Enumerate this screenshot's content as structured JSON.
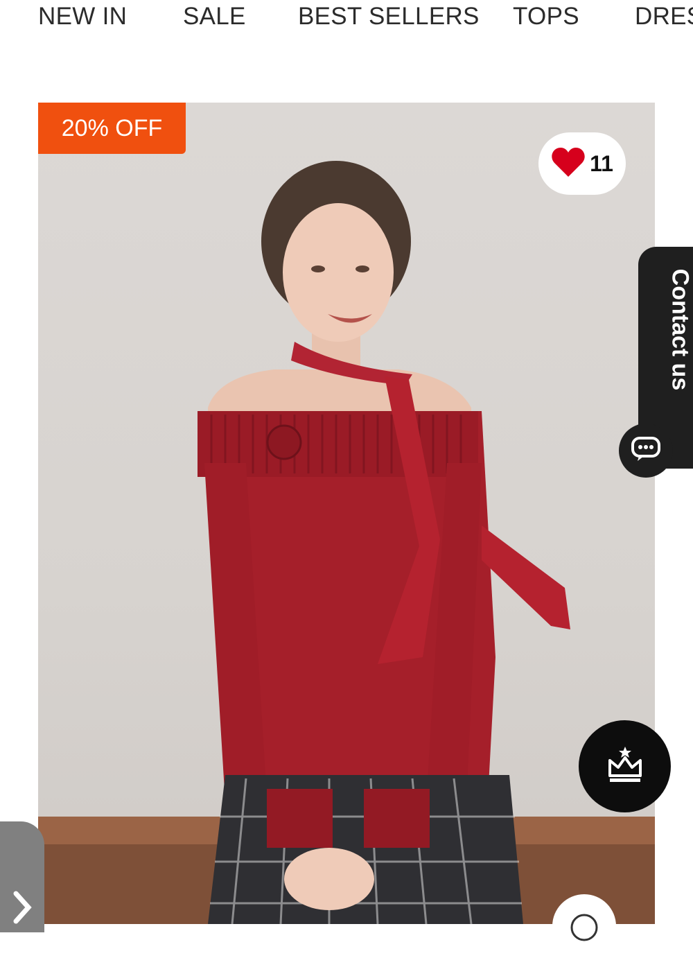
{
  "nav": {
    "items": [
      "NEW IN",
      "SALE",
      "BEST SELLERS",
      "TOPS",
      "DRESSES"
    ]
  },
  "product": {
    "badge": "20% OFF",
    "wishlist_count": "11",
    "image_description_colors": {
      "sweater": "#a51f2a",
      "skirt": "#2f2f33",
      "wall": "#d8d4d0",
      "floor": "#8a5a40"
    }
  },
  "widgets": {
    "contact_label": "Contact us",
    "chat_icon": "chat-icon",
    "crown_icon": "crown-icon",
    "prev_icon": "chevron-right-icon"
  },
  "colors": {
    "badge": "#f0500f",
    "heart": "#d6001c",
    "dark_widget": "#1f1f1f"
  }
}
